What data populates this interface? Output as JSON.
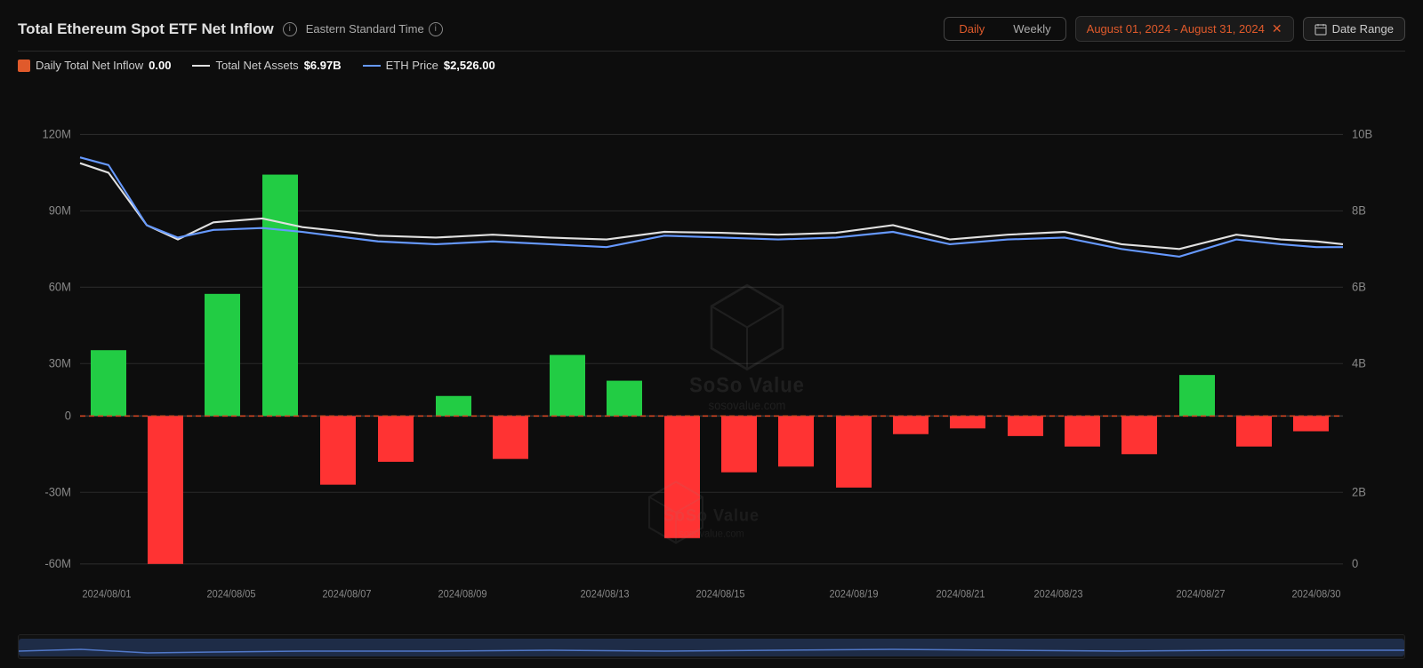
{
  "header": {
    "title": "Total Ethereum Spot ETF Net Inflow",
    "timezone": "Eastern Standard Time",
    "date_range": "August 01, 2024 - August 31, 2024",
    "daily_label": "Daily",
    "weekly_label": "Weekly",
    "date_range_label": "Date Range"
  },
  "legend": {
    "inflow_label": "Daily Total Net Inflow",
    "inflow_value": "0.00",
    "assets_label": "Total Net Assets",
    "assets_value": "$6.97B",
    "eth_label": "ETH Price",
    "eth_value": "$2,526.00"
  },
  "chart": {
    "y_axis_left": [
      "120M",
      "90M",
      "60M",
      "30M",
      "0",
      "-30M",
      "-60M"
    ],
    "y_axis_right": [
      "10B",
      "8B",
      "6B",
      "4B",
      "2B",
      "0"
    ],
    "x_axis": [
      "2024/08/01",
      "2024/08/05",
      "2024/08/07",
      "2024/08/09",
      "2024/08/13",
      "2024/08/15",
      "2024/08/19",
      "2024/08/21",
      "2024/08/23",
      "2024/08/27",
      "2024/08/30"
    ],
    "bars": [
      {
        "date": "08/01",
        "value": 26,
        "positive": true
      },
      {
        "date": "08/02",
        "value": -58,
        "positive": false
      },
      {
        "date": "08/05",
        "value": 48,
        "positive": true
      },
      {
        "date": "08/06",
        "value": 95,
        "positive": true
      },
      {
        "date": "08/07",
        "value": -27,
        "positive": false
      },
      {
        "date": "08/08",
        "value": -18,
        "positive": false
      },
      {
        "date": "08/09",
        "value": 8,
        "positive": true
      },
      {
        "date": "08/12",
        "value": -17,
        "positive": false
      },
      {
        "date": "08/13",
        "value": 24,
        "positive": true
      },
      {
        "date": "08/14",
        "value": 14,
        "positive": true
      },
      {
        "date": "08/15",
        "value": -48,
        "positive": false
      },
      {
        "date": "08/16",
        "value": -22,
        "positive": false
      },
      {
        "date": "08/19",
        "value": -20,
        "positive": false
      },
      {
        "date": "08/20",
        "value": -28,
        "positive": false
      },
      {
        "date": "08/21",
        "value": -7,
        "positive": false
      },
      {
        "date": "08/22",
        "value": -5,
        "positive": false
      },
      {
        "date": "08/23",
        "value": -8,
        "positive": false
      },
      {
        "date": "08/26",
        "value": -12,
        "positive": false
      },
      {
        "date": "08/27",
        "value": -15,
        "positive": false
      },
      {
        "date": "08/28",
        "value": 16,
        "positive": true
      },
      {
        "date": "08/29",
        "value": -12,
        "positive": false
      },
      {
        "date": "08/30",
        "value": -6,
        "positive": false
      }
    ]
  },
  "watermark": {
    "name": "SoSo Value",
    "url": "sosovalue.com"
  }
}
